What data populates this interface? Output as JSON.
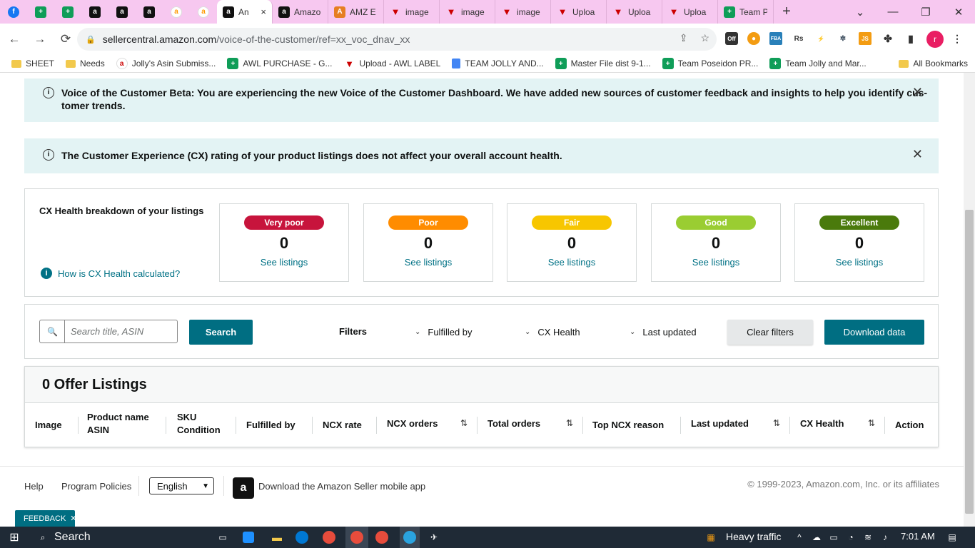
{
  "browser": {
    "tabs": [
      {
        "icon": "f",
        "label": ""
      },
      {
        "icon": "+",
        "label": ""
      },
      {
        "icon": "+",
        "label": ""
      },
      {
        "icon": "a",
        "label": ""
      },
      {
        "icon": "a",
        "label": ""
      },
      {
        "icon": "a",
        "label": ""
      },
      {
        "icon": "a",
        "label": ""
      },
      {
        "icon": "a",
        "label": ""
      },
      {
        "icon": "a",
        "label": "An"
      },
      {
        "icon": "a",
        "label": "Amazo"
      },
      {
        "icon": "A",
        "label": "AMZ E"
      },
      {
        "icon": "▼",
        "label": "image"
      },
      {
        "icon": "▼",
        "label": "image"
      },
      {
        "icon": "▼",
        "label": "image"
      },
      {
        "icon": "▼",
        "label": "Uploa"
      },
      {
        "icon": "▼",
        "label": "Uploa"
      },
      {
        "icon": "▼",
        "label": "Uploa"
      },
      {
        "icon": "+",
        "label": "Team P"
      }
    ],
    "tab_close_glyph": "×",
    "new_tab_glyph": "+",
    "window_controls": {
      "tab_search": "⌄",
      "minimize": "—",
      "restore": "❐",
      "close": "✕"
    },
    "url_host": "sellercentral.amazon.com",
    "url_path": "/voice-of-the-customer/ref=xx_voc_dnav_xx",
    "extension_badge": "Off",
    "profile_initial": "r",
    "bookmarks": [
      {
        "label": "SHEET",
        "type": "folder"
      },
      {
        "label": "Needs",
        "type": "folder"
      },
      {
        "label": "Jolly's Asin Submiss...",
        "type": "amazon"
      },
      {
        "label": "AWL PURCHASE - G...",
        "type": "sheet"
      },
      {
        "label": "Upload - AWL LABEL",
        "type": "upload"
      },
      {
        "label": "TEAM JOLLY AND...",
        "type": "doc"
      },
      {
        "label": "Master File dist 9-1...",
        "type": "sheet"
      },
      {
        "label": "Team Poseidon PR...",
        "type": "sheet"
      },
      {
        "label": "Team Jolly and Mar...",
        "type": "sheet"
      }
    ],
    "all_bookmarks": "All Bookmarks"
  },
  "banners": [
    {
      "line1": "Voice of the Customer Beta: You are experiencing the new Voice of the Customer Dashboard. We have added new sources of customer feedback and insights to help you identify cus-",
      "line2": "tomer trends."
    },
    {
      "line1": "The Customer Experience (CX) rating of your product listings does not affect your overall account health.",
      "line2": ""
    }
  ],
  "cx": {
    "title": "CX Health breakdown of your listings",
    "help_link": "How is CX Health calculated?",
    "buckets": [
      {
        "label": "Very poor",
        "count": "0",
        "link": "See listings",
        "color": "#c7143c"
      },
      {
        "label": "Poor",
        "count": "0",
        "link": "See listings",
        "color": "#ff8c00"
      },
      {
        "label": "Fair",
        "count": "0",
        "link": "See listings",
        "color": "#f7c600"
      },
      {
        "label": "Good",
        "count": "0",
        "link": "See listings",
        "color": "#9acd32"
      },
      {
        "label": "Excellent",
        "count": "0",
        "link": "See listings",
        "color": "#4a7a0c"
      }
    ]
  },
  "search": {
    "placeholder": "Search title, ASIN",
    "button": "Search",
    "filters_label": "Filters",
    "filters": [
      "Fulfilled by",
      "CX Health",
      "Last updated"
    ],
    "clear": "Clear filters",
    "download": "Download data"
  },
  "listings": {
    "title": "0 Offer Listings",
    "columns": [
      {
        "l1": "Image",
        "l2": ""
      },
      {
        "l1": "Product name",
        "l2": "ASIN"
      },
      {
        "l1": "SKU",
        "l2": "Condition"
      },
      {
        "l1": "Fulfilled by",
        "l2": ""
      },
      {
        "l1": "NCX rate",
        "l2": ""
      },
      {
        "l1": "NCX orders",
        "l2": ""
      },
      {
        "l1": "Total orders",
        "l2": ""
      },
      {
        "l1": "Top NCX reason",
        "l2": ""
      },
      {
        "l1": "Last updated",
        "l2": ""
      },
      {
        "l1": "CX Health",
        "l2": ""
      },
      {
        "l1": "Action",
        "l2": ""
      }
    ]
  },
  "footer": {
    "help": "Help",
    "policies": "Program Policies",
    "language": "English",
    "app_text": "Download the Amazon Seller mobile app",
    "copyright": "© 1999-2023, Amazon.com, Inc. or its affiliates"
  },
  "feedback": "FEEDBACK",
  "taskbar": {
    "search": "Search",
    "weather": "Heavy traffic",
    "time": "7:01 AM"
  },
  "colors": {
    "accent": "#006e82",
    "banner_bg": "#e3f3f4",
    "link": "#007185",
    "tabbar": "#f7c8f0"
  }
}
